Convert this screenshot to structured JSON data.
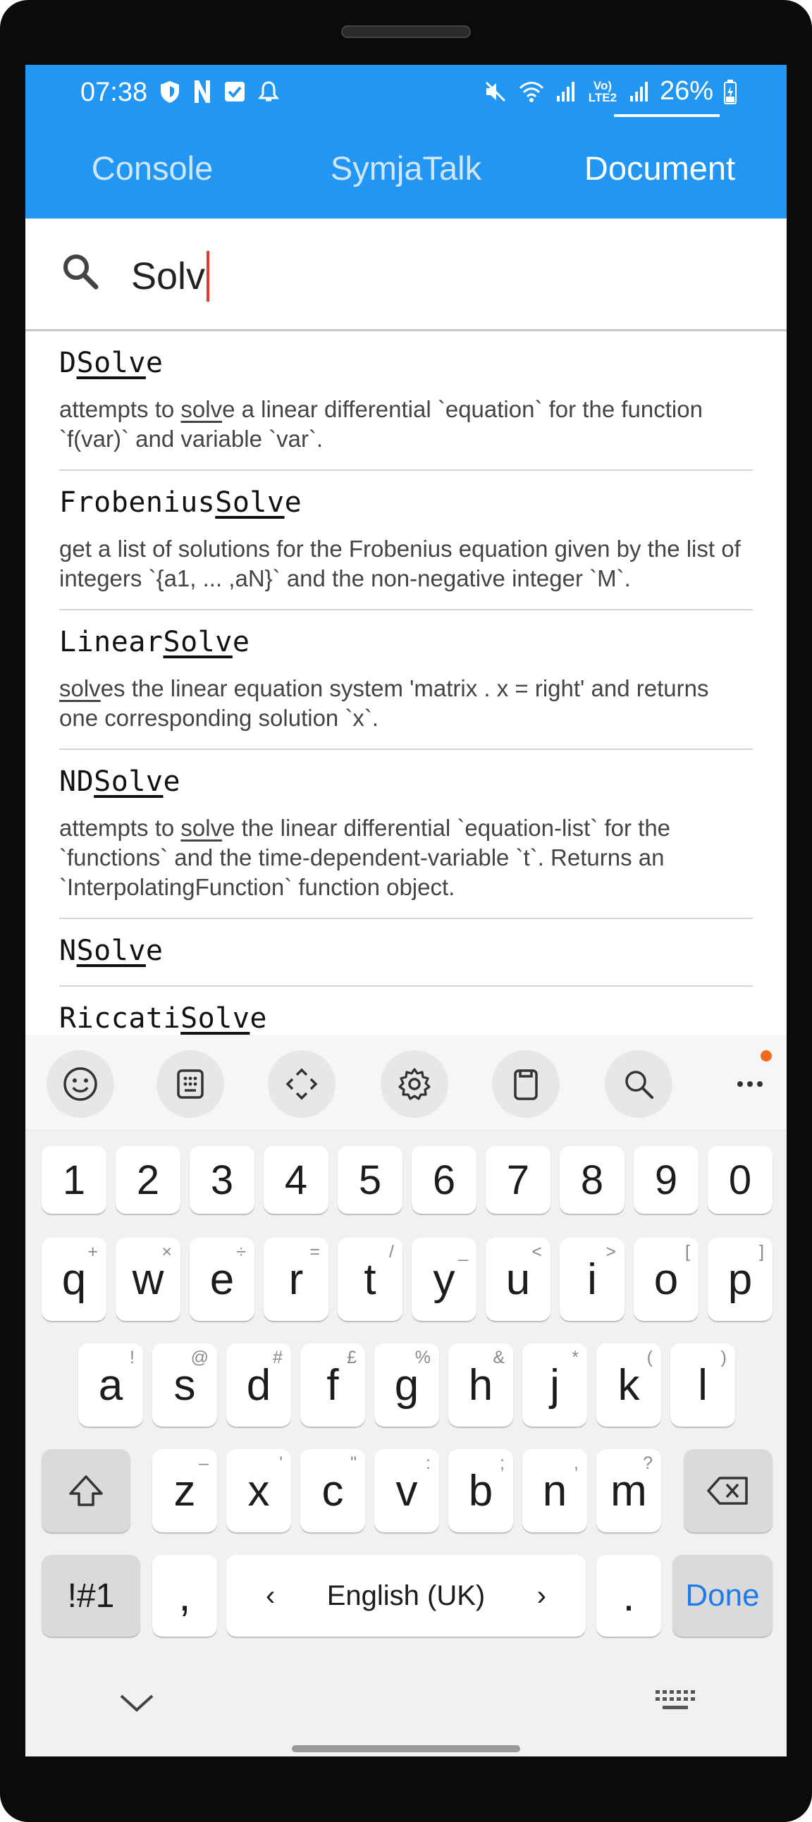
{
  "status_bar": {
    "time": "07:38",
    "left_icons": [
      "shield-icon",
      "n-icon",
      "checkbox-icon",
      "bell-icon"
    ],
    "right_icons": [
      "mute-icon",
      "wifi-icon",
      "signal-icon",
      "volte-icon",
      "signal-icon"
    ],
    "volte": "Vo) LTE2",
    "battery": "26%"
  },
  "tabs": [
    {
      "label": "Console",
      "active": false
    },
    {
      "label": "SymjaTalk",
      "active": false
    },
    {
      "label": "Document",
      "active": true
    }
  ],
  "search": {
    "query": "Solv",
    "icon": "search-icon"
  },
  "results": [
    {
      "prefix": "D",
      "match": "Solv",
      "suffix": "e",
      "desc_pre": "attempts to ",
      "desc_match": "solv",
      "desc_post": "e a linear differential `equation` for the function `f(var)` and variable `var`."
    },
    {
      "prefix": "Frobenius",
      "match": "Solv",
      "suffix": "e",
      "desc_pre": "",
      "desc_match": "",
      "desc_post": "get a list of solutions for the Frobenius equation given by the list of integers `{a1, ... ,aN}` and the non-negative integer `M`."
    },
    {
      "prefix": "Linear",
      "match": "Solv",
      "suffix": "e",
      "desc_pre": "",
      "desc_match": "solv",
      "desc_post": "es the linear equation system 'matrix . x = right' and returns one corresponding solution `x`."
    },
    {
      "prefix": "ND",
      "match": "Solv",
      "suffix": "e",
      "desc_pre": "attempts to ",
      "desc_match": "solv",
      "desc_post": "e the linear differential `equation-list` for the `functions` and the time-dependent-variable `t`. Returns an `InterpolatingFunction` function object."
    },
    {
      "prefix": "N",
      "match": "Solv",
      "suffix": "e",
      "desc_pre": "",
      "desc_match": "",
      "desc_post": ""
    },
    {
      "prefix": "Riccati",
      "match": "Solv",
      "suffix": "e",
      "desc_pre": "",
      "desc_match": "",
      "desc_post": ""
    }
  ],
  "keyboard": {
    "toolbar": [
      "emoji-icon",
      "keypad-icon",
      "cursor-move-icon",
      "settings-icon",
      "clipboard-icon",
      "search-icon",
      "more-icon"
    ],
    "number_row": [
      "1",
      "2",
      "3",
      "4",
      "5",
      "6",
      "7",
      "8",
      "9",
      "0"
    ],
    "row1": [
      {
        "k": "q",
        "h": "+"
      },
      {
        "k": "w",
        "h": "×"
      },
      {
        "k": "e",
        "h": "÷"
      },
      {
        "k": "r",
        "h": "="
      },
      {
        "k": "t",
        "h": "/"
      },
      {
        "k": "y",
        "h": "_"
      },
      {
        "k": "u",
        "h": "<"
      },
      {
        "k": "i",
        "h": ">"
      },
      {
        "k": "o",
        "h": "["
      },
      {
        "k": "p",
        "h": "]"
      }
    ],
    "row2": [
      {
        "k": "a",
        "h": "!"
      },
      {
        "k": "s",
        "h": "@"
      },
      {
        "k": "d",
        "h": "#"
      },
      {
        "k": "f",
        "h": "£"
      },
      {
        "k": "g",
        "h": "%"
      },
      {
        "k": "h",
        "h": "&"
      },
      {
        "k": "j",
        "h": "*"
      },
      {
        "k": "k",
        "h": "("
      },
      {
        "k": "l",
        "h": ")"
      }
    ],
    "row3": [
      {
        "k": "z",
        "h": "–"
      },
      {
        "k": "x",
        "h": "'"
      },
      {
        "k": "c",
        "h": "\""
      },
      {
        "k": "v",
        "h": ":"
      },
      {
        "k": "b",
        "h": ";"
      },
      {
        "k": "n",
        "h": ","
      },
      {
        "k": "m",
        "h": "?"
      }
    ],
    "symbols_label": "!#1",
    "comma_label": ",",
    "space_label": "English (UK)",
    "space_left": "‹",
    "space_right": "›",
    "period_label": ".",
    "done_label": "Done"
  },
  "colors": {
    "accent": "#2196f3",
    "done_text": "#1f7be6",
    "caret": "#e53935",
    "notification_dot": "#f26b1d"
  }
}
